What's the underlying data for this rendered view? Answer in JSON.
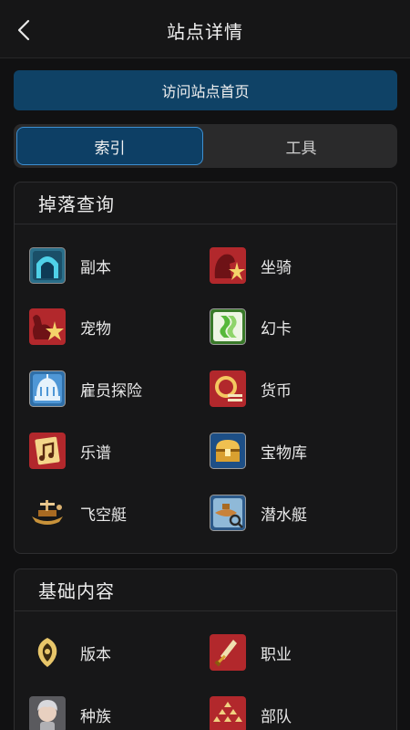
{
  "header": {
    "title": "站点详情"
  },
  "visit_button": {
    "label": "访问站点首页"
  },
  "tabs": [
    {
      "label": "索引",
      "active": true
    },
    {
      "label": "工具",
      "active": false
    }
  ],
  "drop_query": {
    "title": "掉落查询",
    "items": [
      {
        "label": "副本",
        "icon": "dungeon-icon"
      },
      {
        "label": "坐骑",
        "icon": "mount-icon"
      },
      {
        "label": "宠物",
        "icon": "pet-icon"
      },
      {
        "label": "幻卡",
        "icon": "card-icon"
      },
      {
        "label": "雇员探险",
        "icon": "retainer-venture-icon"
      },
      {
        "label": "货币",
        "icon": "currency-icon"
      },
      {
        "label": "乐谱",
        "icon": "music-score-icon"
      },
      {
        "label": "宝物库",
        "icon": "treasure-icon"
      },
      {
        "label": "飞空艇",
        "icon": "airship-icon"
      },
      {
        "label": "潜水艇",
        "icon": "submarine-icon"
      }
    ]
  },
  "basic_content": {
    "title": "基础内容",
    "items": [
      {
        "label": "版本",
        "icon": "version-icon"
      },
      {
        "label": "职业",
        "icon": "job-icon"
      },
      {
        "label": "种族",
        "icon": "race-icon"
      },
      {
        "label": "部队",
        "icon": "company-icon"
      }
    ]
  },
  "colors": {
    "background": "#111112",
    "accent": "#0f4266",
    "tab_active_border": "#3d8fd1"
  }
}
